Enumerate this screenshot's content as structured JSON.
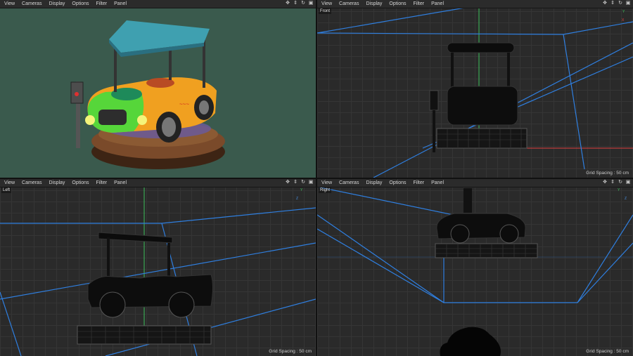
{
  "menu": [
    "View",
    "Cameras",
    "Display",
    "Options",
    "Filter",
    "Panel"
  ],
  "nav_icons": [
    "move-icon",
    "zoom-icon",
    "rotate-icon",
    "maximize-icon"
  ],
  "viewports": {
    "perspective": {
      "name": ""
    },
    "front": {
      "name": "Front",
      "grid_spacing": "Grid Spacing : 50 cm"
    },
    "left": {
      "name": "Left",
      "grid_spacing": "Grid Spacing : 50 cm"
    },
    "right": {
      "name": "Right",
      "grid_spacing": "Grid Spacing : 50 cm"
    }
  },
  "axes": {
    "y": "Y",
    "x": "X",
    "z": "Z"
  },
  "colors": {
    "x_axis": "#e04040",
    "y_axis": "#3cbf5a",
    "z_axis": "#4a90e2",
    "bounds": "#2f7fe0"
  }
}
